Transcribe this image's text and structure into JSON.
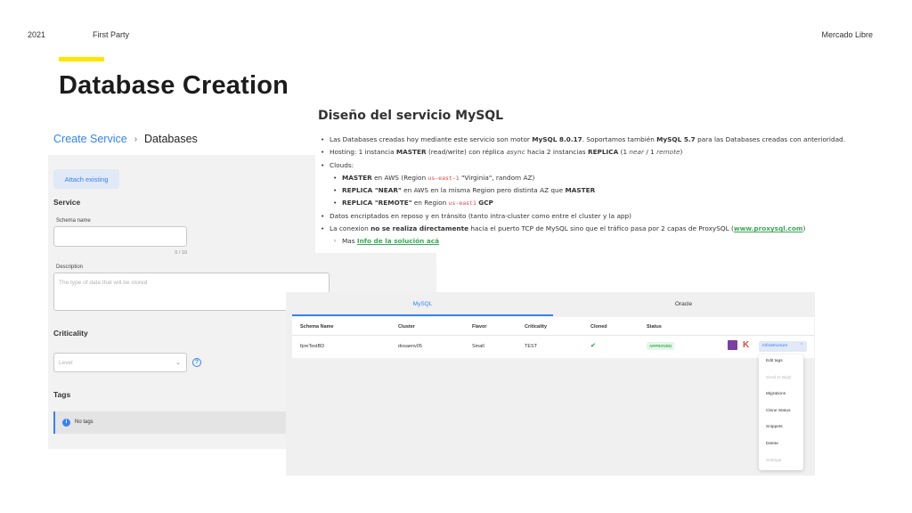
{
  "header": {
    "year": "2021",
    "section": "First Party",
    "company": "Mercado Libre"
  },
  "slide": {
    "title": "Database Creation",
    "accent_color": "#ffe600"
  },
  "form": {
    "breadcrumb": {
      "parent": "Create Service",
      "separator": "›",
      "current": "Databases"
    },
    "attach_button": "Attach existing",
    "service_label": "Service",
    "schema_name_label": "Schema name",
    "schema_name_value": "",
    "schema_counter": "0 / 10",
    "description_label": "Description",
    "description_placeholder": "The type of data that will be stored",
    "criticality_label": "Criticality",
    "criticality_placeholder": "Level",
    "tags_label": "Tags",
    "no_tags_text": "No tags"
  },
  "doc": {
    "title": "Diseño del servicio MySQL",
    "bullets": {
      "b1_pre": "Las Databases creadas hoy mediante este servicio son motor ",
      "b1_v1": "MySQL 8.0.17",
      "b1_mid": ". Soportamos también ",
      "b1_v2": "MySQL 5.7",
      "b1_post": " para las Databases creadas con anterioridad.",
      "b2_pre": "Hosting: 1 instancia ",
      "b2_master": "MASTER",
      "b2_mid1": " (read/write) con réplica ",
      "b2_async": "async",
      "b2_mid2": " hacia 2 instancias ",
      "b2_replica": "REPLICA",
      "b2_mid3": " (1 ",
      "b2_near": "near",
      "b2_mid4": " / 1 ",
      "b2_remote": "remote",
      "b2_post": ")",
      "b3": "Clouds:",
      "s1_name": "MASTER",
      "s1_pre": " en AWS (Region ",
      "s1_code": "us-east-1",
      "s1_post": " \"Virginia\", random AZ)",
      "s2_name": "REPLICA \"NEAR\"",
      "s2_pre": " en AWS en la misma Region pero distinta AZ que ",
      "s2_master": "MASTER",
      "s3_name": "REPLICA \"REMOTE\"",
      "s3_pre": " en Region ",
      "s3_code": "us-east1",
      "s3_gcp": "GCP",
      "b4": "Datos encriptados en reposo y en tránsito (tanto intra-cluster como entre el cluster y la app)",
      "b5_pre": "La conexion ",
      "b5_bold": "no se realiza directamente",
      "b5_mid": " hacia el puerto TCP de MySQL sino que el tráfico pasa por 2 capas de ProxySQL (",
      "b5_link": "www.proxysql.com",
      "b5_post": ")",
      "s4_pre": "Mas ",
      "s4_link": "Info de la solución acá"
    }
  },
  "table": {
    "tabs": [
      "MySQL",
      "Oracle"
    ],
    "columns": [
      "Schema Name",
      "Cluster",
      "Flavor",
      "Criticality",
      "Cloned",
      "Status"
    ],
    "row": {
      "schema_name": "fpreTestBD",
      "cluster": "dosaenv05",
      "flavor": "Small",
      "criticality": "TEST",
      "cloned": "✔",
      "status": "APPROVED"
    },
    "action_button": "Infrastructure",
    "action_chevron": "⌃",
    "menu": [
      "Edit tags",
      "Send to BigQ",
      "Migrations",
      "Clone Status",
      "Snippets",
      "Delete",
      "Settings"
    ]
  },
  "colors": {
    "primary": "#3483fa",
    "success": "#39b54a",
    "code": "#e0474c"
  }
}
